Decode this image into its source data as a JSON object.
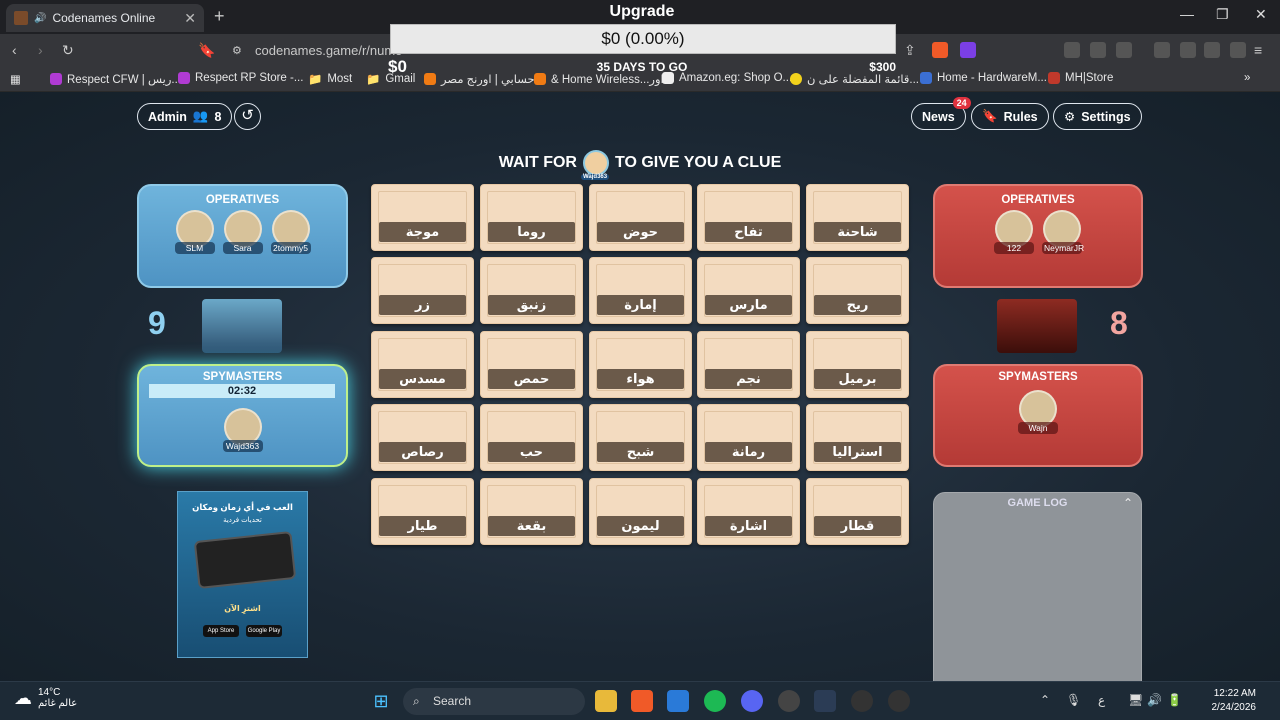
{
  "browser": {
    "tab_title": "Codenames Online",
    "url": "codenames.game/r/numo",
    "bookmarks": [
      "Respect CFW | ريس...",
      "Respect RP Store -...",
      "Most",
      "Gmail",
      "حسابي | اورنج مصر",
      "& Home Wireless...اور",
      "Amazon.eg: Shop O...",
      "قائمة المفضلة على ن...",
      "Home - HardwareM...",
      "MH|Store"
    ]
  },
  "upgrade": {
    "title": "Upgrade",
    "amount": "$0 (0.00%)",
    "min": "$0",
    "days": "35 DAYS TO GO",
    "max": "$300",
    "progress": 0
  },
  "header": {
    "admin_label": "Admin",
    "player_count": "8",
    "news_label": "News",
    "news_badge": "24",
    "rules_label": "Rules",
    "settings_label": "Settings"
  },
  "clue": {
    "prefix": "WAIT FOR",
    "suffix": "TO GIVE YOU A CLUE",
    "avatar_name": "Wajd363"
  },
  "blue_team": {
    "operatives_title": "OPERATIVES",
    "operatives": [
      "SLM",
      "Sara",
      "2tommy5"
    ],
    "score": "9",
    "spymasters_title": "SPYMASTERS",
    "timer": "02:32",
    "spymaster": "Wajd363"
  },
  "red_team": {
    "operatives_title": "OPERATIVES",
    "operatives": [
      "122",
      "NeymarJR"
    ],
    "score": "8",
    "spymasters_title": "SPYMASTERS",
    "spymaster": "Wajn"
  },
  "board": {
    "words": [
      [
        "موجة",
        "روما",
        "حوض",
        "تفاح",
        "شاحنة"
      ],
      [
        "زر",
        "زنبق",
        "إمارة",
        "مارس",
        "ريح"
      ],
      [
        "مسدس",
        "حمص",
        "هواء",
        "نجم",
        "برميل"
      ],
      [
        "رصاص",
        "حب",
        "شبح",
        "رمانة",
        "استراليا"
      ],
      [
        "طيار",
        "بقعة",
        "ليمون",
        "اشارة",
        "قطار"
      ]
    ]
  },
  "ad": {
    "line1": "العب في أي زمان ومكان",
    "line2": "تحديات فردية",
    "cta": "اشترِ الآن",
    "store1": "App Store",
    "store2": "Google Play"
  },
  "game_log": {
    "title": "GAME LOG"
  },
  "taskbar": {
    "temp": "14°C",
    "weather_text": "عالم غائم",
    "search": "Search",
    "lang": "ع",
    "time": "12:22 AM",
    "date": "2/24/2026"
  }
}
